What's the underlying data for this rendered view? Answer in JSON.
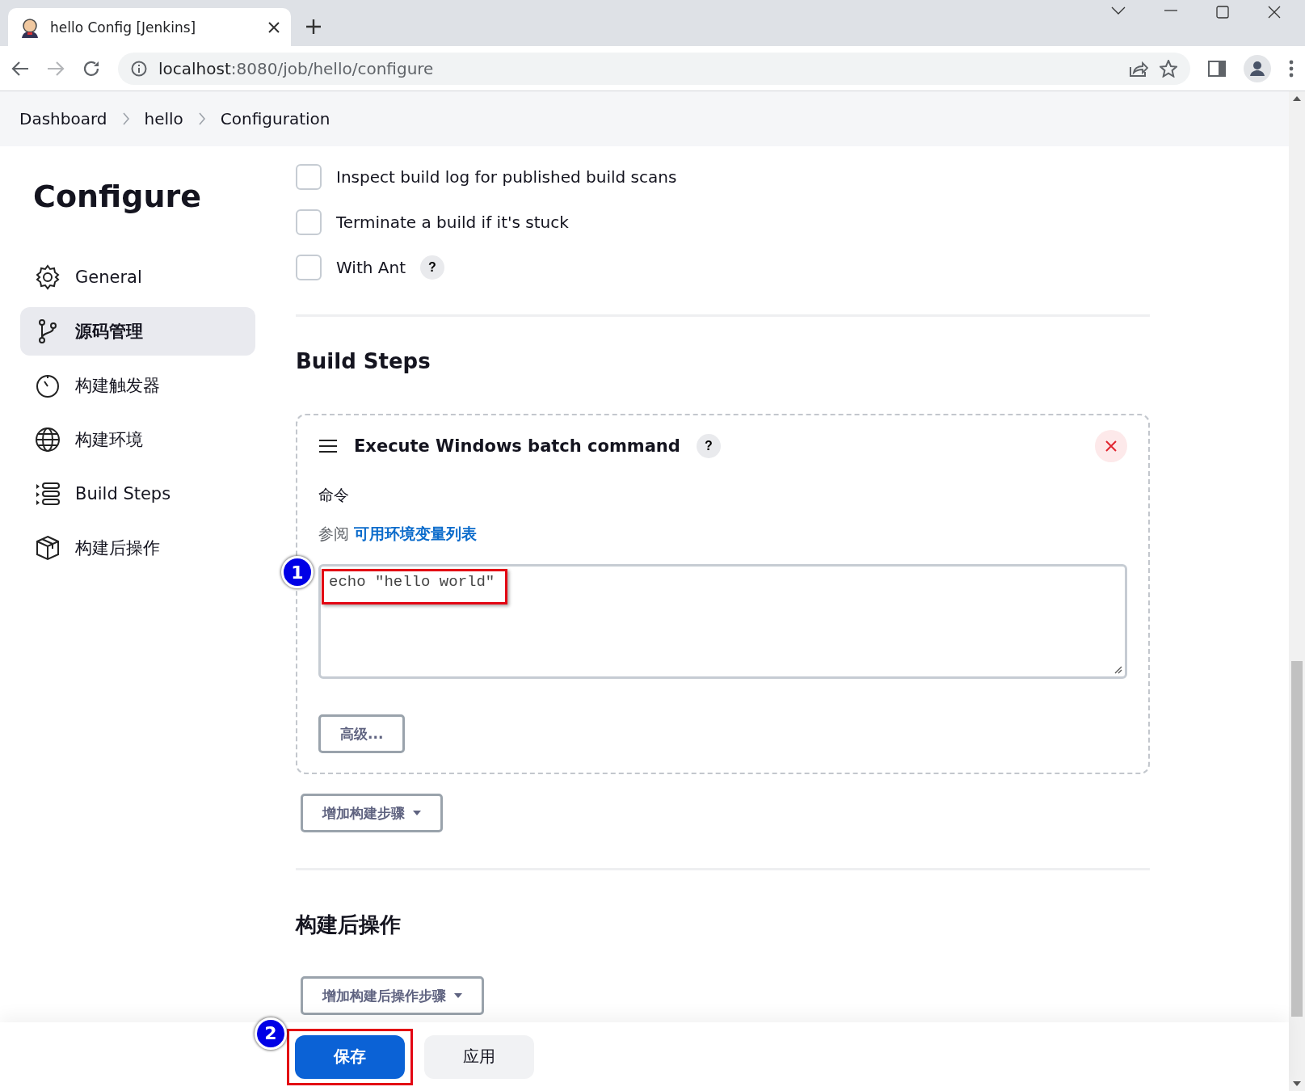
{
  "browser": {
    "tab": {
      "title": "hello Config [Jenkins]"
    },
    "address": {
      "host": "localhost",
      "path": ":8080/job/hello/configure"
    }
  },
  "breadcrumbs": [
    {
      "label": "Dashboard"
    },
    {
      "label": "hello"
    },
    {
      "label": "Configuration"
    }
  ],
  "sidebar": {
    "title": "Configure",
    "items": [
      {
        "label": "General",
        "selected": false
      },
      {
        "label": "源码管理",
        "selected": true
      },
      {
        "label": "构建触发器",
        "selected": false
      },
      {
        "label": "构建环境",
        "selected": false
      },
      {
        "label": "Build Steps",
        "selected": false
      },
      {
        "label": "构建后操作",
        "selected": false
      }
    ]
  },
  "options": [
    {
      "label": "Inspect build log for published build scans",
      "checked": false
    },
    {
      "label": "Terminate a build if it's stuck",
      "checked": false
    },
    {
      "label": "With Ant",
      "checked": false,
      "help": "?"
    }
  ],
  "build_steps": {
    "title": "Build Steps",
    "steps": [
      {
        "title": "Execute Windows batch command",
        "help": "?",
        "field_label": "命令",
        "see_also": "参阅",
        "link": "可用环境变量列表",
        "command": "echo \"hello world\"",
        "annotation": "1",
        "advanced_button": "高级..."
      }
    ],
    "add_button": "增加构建步骤"
  },
  "post_build": {
    "title": "构建后操作",
    "add_button": "增加构建后操作步骤"
  },
  "footer": {
    "buttons": [
      {
        "label": "保存",
        "kind": "primary",
        "annotation": "2"
      },
      {
        "label": "应用",
        "kind": "secondary"
      }
    ]
  }
}
